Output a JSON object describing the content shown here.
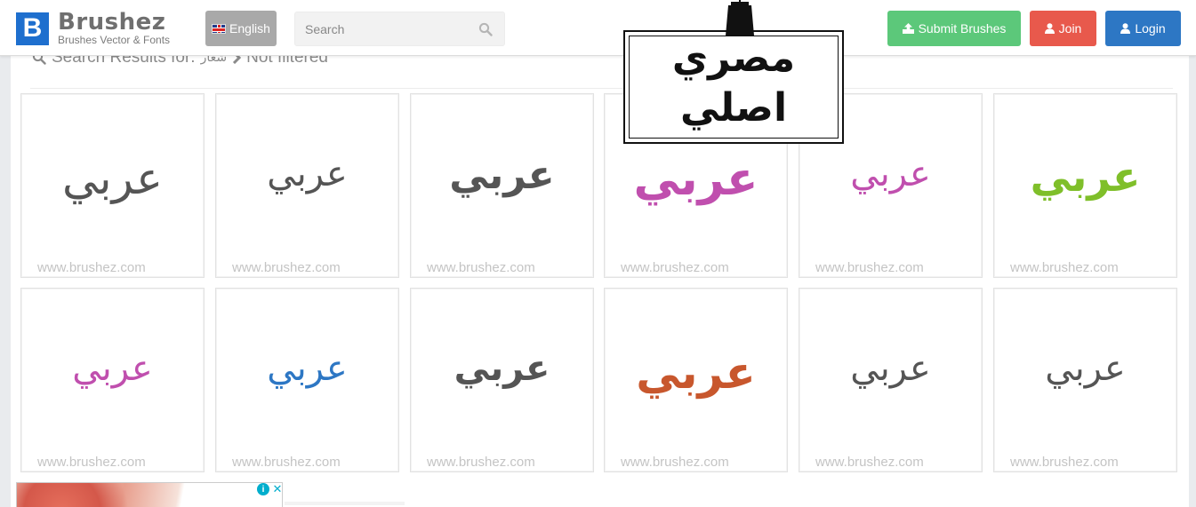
{
  "header": {
    "logo_letter": "B",
    "logo_name": "Brushez",
    "logo_tagline": "Brushes Vector & Fonts",
    "language_label": "English",
    "search_placeholder": "Search",
    "submit_label": "Submit Brushes",
    "join_label": "Join",
    "login_label": "Login",
    "colors": {
      "brand": "#1e6fce",
      "submit": "#5cc87a",
      "join": "#e8594c",
      "login": "#2d77c4",
      "lang": "#a9a9a9"
    }
  },
  "stamp": {
    "line1": "مصري",
    "line2": "اصلي"
  },
  "results": {
    "prefix": "Search Results for:",
    "query": "شعار",
    "filter": "Not filtered"
  },
  "cards": [
    {
      "glyph": "عربي",
      "color": "#555555",
      "size": "50px",
      "weight": "normal",
      "watermark": "www.brushez.com"
    },
    {
      "glyph": "عربي",
      "color": "#555555",
      "size": "40px",
      "weight": "normal",
      "watermark": "www.brushez.com"
    },
    {
      "glyph": "عربي",
      "color": "#555555",
      "size": "44px",
      "weight": "bold",
      "watermark": "www.brushez.com"
    },
    {
      "glyph": "عربي",
      "color": "#c04fae",
      "size": "52px",
      "weight": "bold",
      "watermark": "www.brushez.com"
    },
    {
      "glyph": "عربي",
      "color": "#c04fae",
      "size": "40px",
      "weight": "normal",
      "watermark": "www.brushez.com"
    },
    {
      "glyph": "عربي",
      "color": "#7fbf2a",
      "size": "46px",
      "weight": "bold",
      "watermark": "www.brushez.com"
    },
    {
      "glyph": "عربي",
      "color": "#c04fae",
      "size": "40px",
      "weight": "normal",
      "watermark": "www.brushez.com"
    },
    {
      "glyph": "عربي",
      "color": "#2d77c4",
      "size": "40px",
      "weight": "normal",
      "watermark": "www.brushez.com"
    },
    {
      "glyph": "عربي",
      "color": "#555555",
      "size": "40px",
      "weight": "bold",
      "watermark": "www.brushez.com"
    },
    {
      "glyph": "عربي",
      "color": "#c8572d",
      "size": "50px",
      "weight": "bold",
      "watermark": "www.brushez.com"
    },
    {
      "glyph": "عربي",
      "color": "#555555",
      "size": "40px",
      "weight": "normal",
      "watermark": "www.brushez.com"
    },
    {
      "glyph": "عربي",
      "color": "#555555",
      "size": "40px",
      "weight": "normal",
      "watermark": "www.brushez.com"
    }
  ],
  "ad": {
    "info_symbol": "i",
    "close_symbol": "✕"
  }
}
